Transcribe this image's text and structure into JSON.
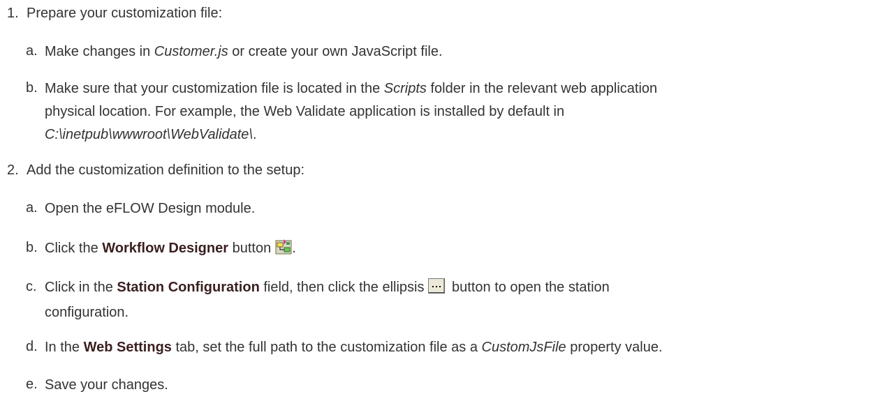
{
  "steps": [
    {
      "number": "1.",
      "text": "Prepare your customization file:",
      "substeps": [
        {
          "letter": "a.",
          "parts": [
            "Make changes in ",
            "Customer.js",
            " or create your own JavaScript file."
          ]
        },
        {
          "letter": "b.",
          "lines": [
            [
              "Make sure that your customization file is located in the ",
              "Scripts",
              " folder in the relevant web application"
            ],
            [
              "physical location. For example, the Web Validate application is installed by default in"
            ],
            [
              "C:\\inetpub\\wwwroot\\WebValidate\\",
              "."
            ]
          ]
        }
      ]
    },
    {
      "number": "2.",
      "text": "Add the customization definition to the setup:",
      "substeps": [
        {
          "letter": "a.",
          "parts": [
            "Open the eFLOW Design module."
          ]
        },
        {
          "letter": "b.",
          "parts": [
            "Click the ",
            "Workflow Designer",
            " button",
            "."
          ],
          "icon": "workflow-designer-icon"
        },
        {
          "letter": "c.",
          "lines": [
            [
              "Click in the ",
              "Station Configuration",
              " field, then click the ellipsis",
              " button to open the station"
            ],
            [
              "configuration."
            ]
          ],
          "icon": "ellipsis-button-icon"
        },
        {
          "letter": "d.",
          "parts": [
            "In the  ",
            "Web Settings",
            " tab, set the full path to the customization file as a ",
            "CustomJsFile",
            " property value."
          ]
        },
        {
          "letter": "e.",
          "parts": [
            "Save your changes."
          ]
        }
      ]
    }
  ],
  "colors": {
    "text": "#333333",
    "bold": "#3a1f1f"
  }
}
